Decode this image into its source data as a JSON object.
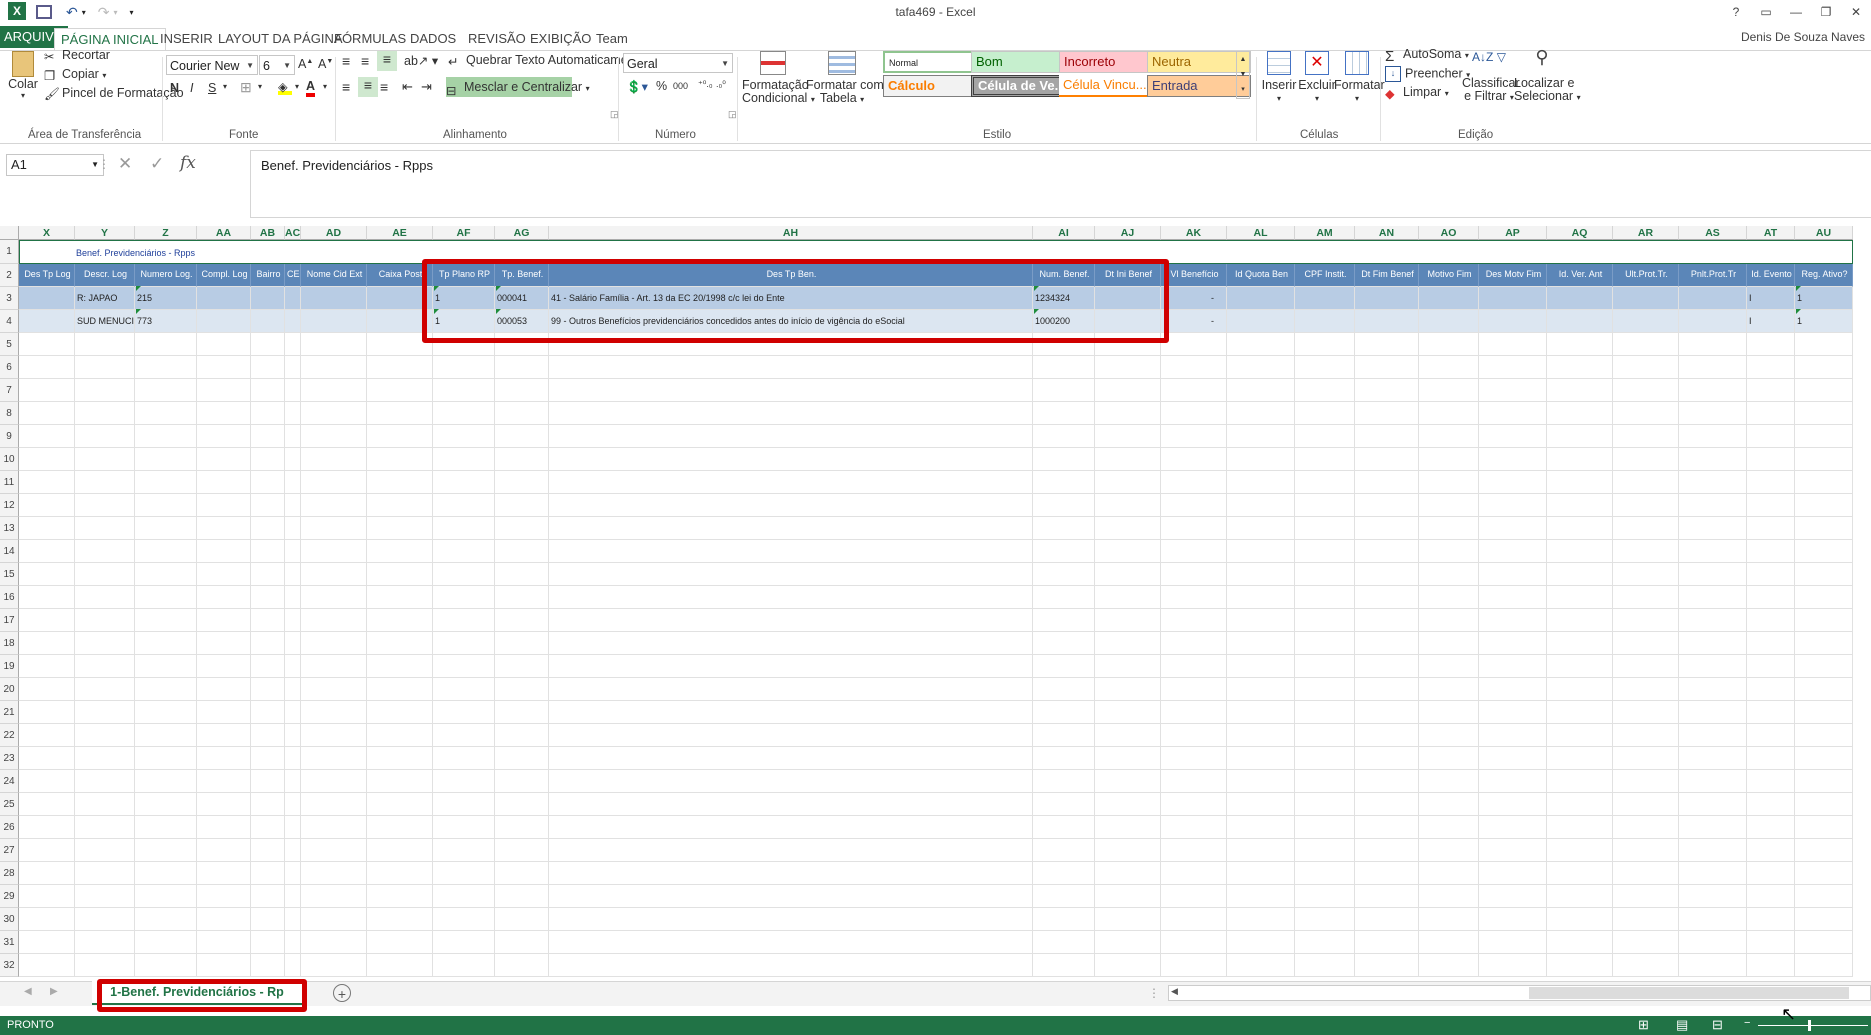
{
  "window": {
    "title": "tafa469 - Excel",
    "user": "Denis De Souza Naves",
    "help": "?",
    "logo": "X"
  },
  "tabs": [
    "ARQUIVO",
    "PÁGINA INICIAL",
    "INSERIR",
    "LAYOUT DA PÁGINA",
    "FÓRMULAS",
    "DADOS",
    "REVISÃO",
    "EXIBIÇÃO",
    "Team"
  ],
  "ribbon": {
    "clipboard": {
      "paste": "Colar",
      "cut": "Recortar",
      "copy": "Copiar",
      "format_painter": "Pincel de Formatação",
      "label": "Área de Transferência"
    },
    "font": {
      "name": "Courier New",
      "size": "6",
      "bold": "N",
      "italic": "I",
      "underline": "S",
      "font_color": "A",
      "label": "Fonte"
    },
    "alignment": {
      "wrap": "Quebrar Texto Automaticamente",
      "merge": "Mesclar e Centralizar",
      "label": "Alinhamento"
    },
    "number": {
      "format": "Geral",
      "percent": "%",
      "thousands": "000",
      "label": "Número"
    },
    "styles": {
      "cond_format_1": "Formatação",
      "cond_format_2": "Condicional",
      "format_table_1": "Formatar como",
      "format_table_2": "Tabela",
      "normal": "Normal",
      "bom": "Bom",
      "incorreto": "Incorreto",
      "neutra": "Neutra",
      "calculo": "Cálculo",
      "celula_ver": "Célula de Ve...",
      "celula_vinc": "Célula Vincu...",
      "entrada": "Entrada",
      "label": "Estilo"
    },
    "cells": {
      "insert": "Inserir",
      "delete": "Excluir",
      "format": "Formatar",
      "label": "Células"
    },
    "editing": {
      "autosum": "AutoSoma",
      "fill": "Preencher",
      "clear": "Limpar",
      "sort_1": "Classificar",
      "sort_2": "e Filtrar",
      "find_1": "Localizar e",
      "find_2": "Selecionar",
      "label": "Edição"
    }
  },
  "formula_bar": {
    "name_box": "A1",
    "fx": "fx",
    "value": "Benef. Previdenciários - Rpps"
  },
  "columns": [
    "X",
    "Y",
    "Z",
    "AA",
    "AB",
    "AC",
    "AD",
    "AE",
    "AF",
    "AG",
    "AH",
    "AI",
    "AJ",
    "AK",
    "AL",
    "AM",
    "AN",
    "AO",
    "AP",
    "AQ",
    "AR",
    "AS",
    "AT",
    "AU"
  ],
  "row_numbers": [
    "1",
    "2",
    "3",
    "4",
    "5",
    "6",
    "7",
    "8",
    "9",
    "10",
    "11",
    "12",
    "13",
    "14",
    "15",
    "16",
    "17",
    "18",
    "19",
    "20",
    "21",
    "22",
    "23",
    "24",
    "25",
    "26",
    "27",
    "28",
    "29",
    "30",
    "31",
    "32"
  ],
  "sheet": {
    "title_row": "Benef. Previdenciários - Rpps",
    "headers": [
      "Des Tp Log",
      "Descr. Log",
      "Numero Log.",
      "Compl. Log",
      "Bairro",
      "CEP",
      "Nome Cid Ext",
      "Caixa Post",
      "Tp Plano RP",
      "Tp. Benef.",
      "Des Tp Ben.",
      "Num. Benef.",
      "Dt Ini Benef",
      "Vl Benefício",
      "Id Quota Ben",
      "CPF Instit.",
      "Dt Fim Benef",
      "Motivo Fim",
      "Des Motv Fim",
      "Id. Ver. Ant",
      "Ult.Prot.Tr.",
      "Pnlt.Prot.Tr",
      "Id. Evento",
      "Reg. Ativo?"
    ],
    "rows": [
      [
        "",
        "R: JAPAO",
        "215",
        "",
        "",
        "",
        "",
        "",
        "1",
        "000041",
        "41 - Salário Família - Art. 13 da EC 20/1998 c/c lei do Ente",
        "1234324",
        "",
        "-",
        "",
        "",
        "",
        "",
        "",
        "",
        "",
        "",
        "I",
        "1"
      ],
      [
        "",
        "SUD MENUCI",
        "773",
        "",
        "",
        "",
        "",
        "",
        "1",
        "000053",
        "99 - Outros Benefícios previdenciários concedidos antes do início de vigência do eSocial",
        "1000200",
        "",
        "-",
        "",
        "",
        "",
        "",
        "",
        "",
        "",
        "",
        "I",
        "1"
      ]
    ]
  },
  "sheet_tab": "1-Benef. Previdenciários - Rp",
  "status": "PRONTO"
}
